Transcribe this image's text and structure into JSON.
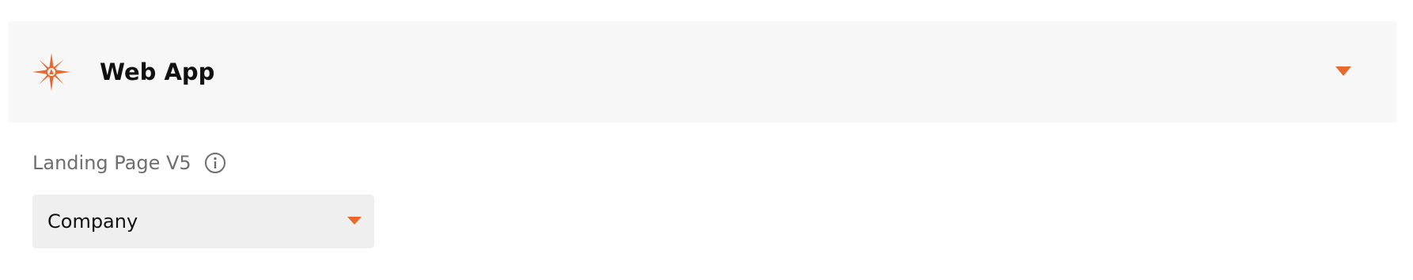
{
  "accordion": {
    "title": "Web App",
    "icon": "compass-icon",
    "expanded": true
  },
  "field": {
    "label": "Landing Page V5",
    "info_icon": "info-icon",
    "selected_value": "Company"
  },
  "colors": {
    "accent": "#e8692f",
    "header_bg": "#f7f7f7",
    "select_bg": "#efefef",
    "label_text": "#6e6e6e"
  }
}
